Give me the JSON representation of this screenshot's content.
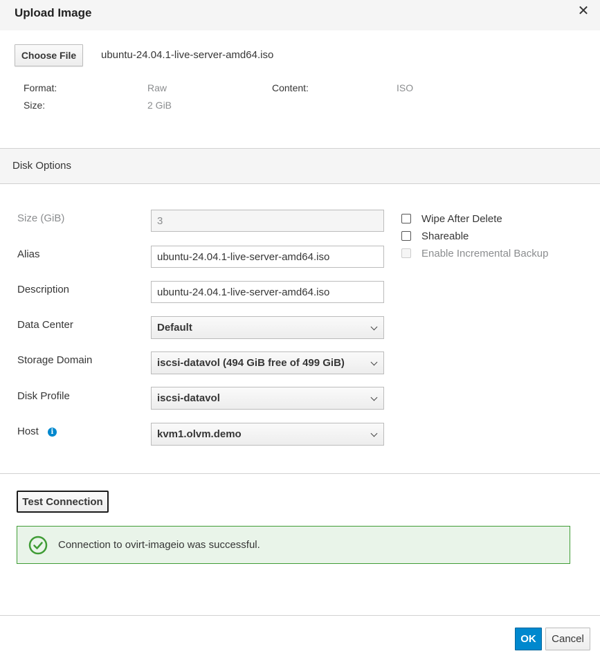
{
  "dialog": {
    "title": "Upload Image",
    "close_icon": "close-icon"
  },
  "file": {
    "choose_label": "Choose File",
    "filename": "ubuntu-24.04.1-live-server-amd64.iso",
    "format_label": "Format:",
    "format_value": "Raw",
    "content_label": "Content:",
    "content_value": "ISO",
    "size_label": "Size:",
    "size_value": "2 GiB"
  },
  "disk_options": {
    "section_title": "Disk Options",
    "size": {
      "label": "Size (GiB)",
      "value": "3"
    },
    "alias": {
      "label": "Alias",
      "value": "ubuntu-24.04.1-live-server-amd64.iso"
    },
    "description": {
      "label": "Description",
      "value": "ubuntu-24.04.1-live-server-amd64.iso"
    },
    "data_center": {
      "label": "Data Center",
      "value": "Default"
    },
    "storage_domain": {
      "label": "Storage Domain",
      "value": "iscsi-datavol (494 GiB free of 499 GiB)"
    },
    "disk_profile": {
      "label": "Disk Profile",
      "value": "iscsi-datavol"
    },
    "host": {
      "label": "Host",
      "value": "kvm1.olvm.demo",
      "icon": "info-icon"
    },
    "checkboxes": {
      "wipe_after_delete": {
        "label": "Wipe After Delete",
        "checked": false
      },
      "shareable": {
        "label": "Shareable",
        "checked": false
      },
      "incremental_backup": {
        "label": "Enable Incremental Backup",
        "checked": false,
        "disabled": true
      }
    }
  },
  "connection": {
    "test_label": "Test Connection",
    "status_message": "Connection to ovirt-imageio was successful.",
    "status_icon": "check-circle-icon",
    "status_color": "#3f9c35"
  },
  "footer": {
    "ok_label": "OK",
    "cancel_label": "Cancel",
    "primary_color": "#0088ce"
  }
}
